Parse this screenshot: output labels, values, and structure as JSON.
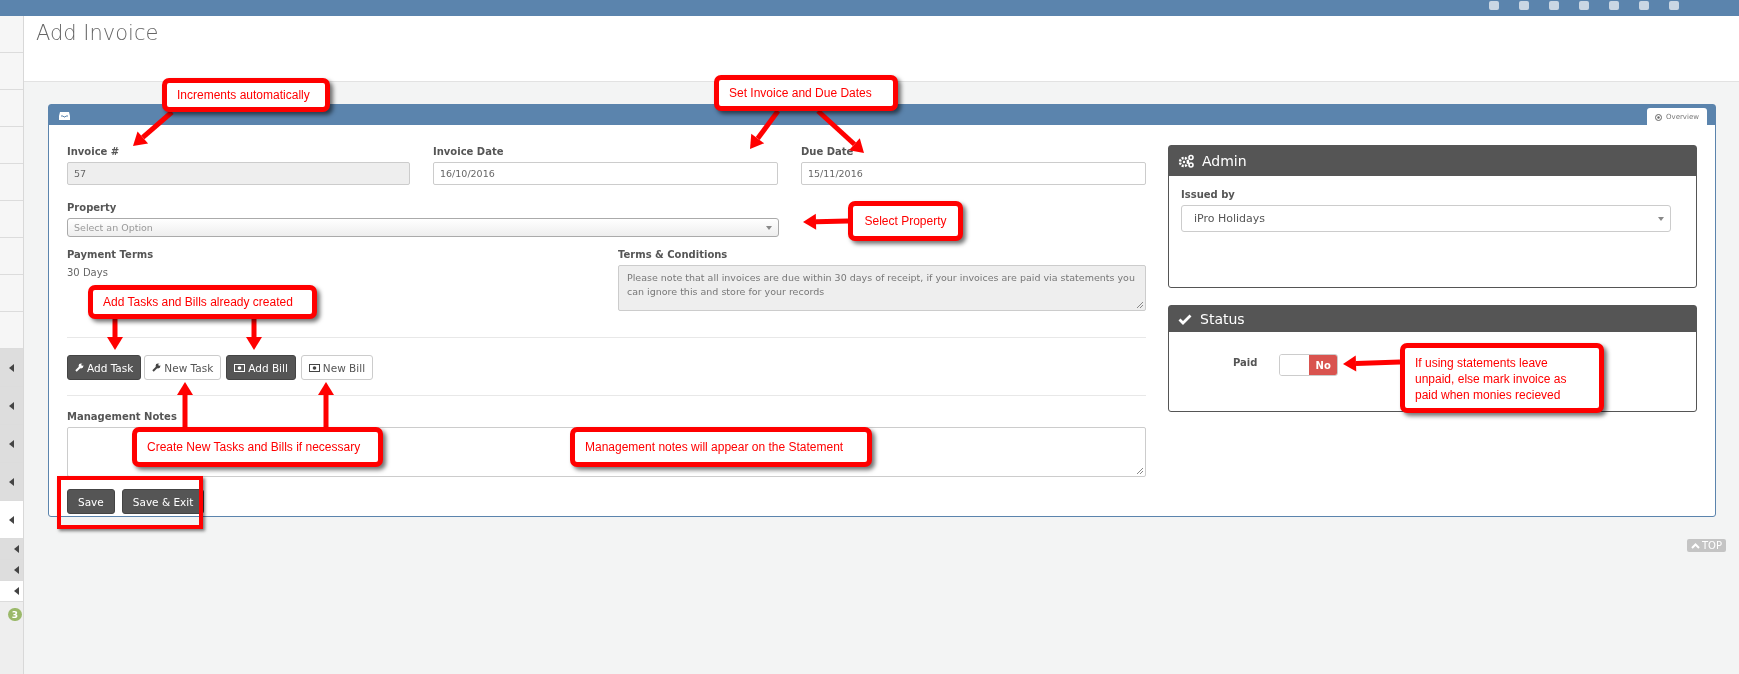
{
  "sidebar": {
    "items": [
      {
        "kind": "plain"
      },
      {
        "kind": "plain"
      },
      {
        "kind": "plain"
      },
      {
        "kind": "plain"
      },
      {
        "kind": "plain"
      },
      {
        "kind": "plain"
      },
      {
        "kind": "plain"
      },
      {
        "kind": "plain"
      },
      {
        "kind": "plain"
      },
      {
        "kind": "menu",
        "selected": false
      },
      {
        "kind": "menu",
        "selected": false
      },
      {
        "kind": "menu",
        "selected": false
      },
      {
        "kind": "menu",
        "selected": false
      },
      {
        "kind": "menu",
        "selected": true
      },
      {
        "kind": "sub",
        "selected": false
      },
      {
        "kind": "sub",
        "selected": false
      },
      {
        "kind": "sub",
        "selected": true
      }
    ],
    "badge": "3"
  },
  "page_title": "Add Invoice",
  "panel": {
    "tabs": [
      {
        "label": "Overview",
        "selected": true
      }
    ]
  },
  "fields": [
    {
      "label": "Invoice #",
      "value": "57",
      "disabled": true
    },
    {
      "label": "Invoice Date",
      "value": "16/10/2016",
      "disabled": false
    },
    {
      "label": "Due Date",
      "value": "15/11/2016",
      "disabled": false
    }
  ],
  "property": {
    "label": "Property",
    "placeholder": "Select an Option"
  },
  "payment_terms": {
    "label": "Payment Terms",
    "value": "30 Days"
  },
  "terms": {
    "label": "Terms & Conditions",
    "value": "Please note that all invoices are due within 30 days of receipt, if your invoices are paid via statements you can ignore this and store for your records",
    "disabled": true
  },
  "item_buttons": [
    {
      "label": "Add Task",
      "kind": "primary"
    },
    {
      "label": "New Task",
      "kind": "default"
    },
    {
      "label": "Add Bill",
      "kind": "primary"
    },
    {
      "label": "New Bill",
      "kind": "default"
    }
  ],
  "notes": {
    "label": "Management Notes"
  },
  "actions": [
    "Save",
    "Save & Exit"
  ],
  "admin": {
    "title": "Admin",
    "issued_by": {
      "label": "Issued by",
      "value": "iPro Holidays"
    }
  },
  "status": {
    "title": "Status",
    "paid": {
      "label": "Paid",
      "on": false,
      "text": "No"
    }
  },
  "top_link": "TOP",
  "callouts": [
    {
      "text": "Increments automatically"
    },
    {
      "text": "Set Invoice and Due Dates"
    },
    {
      "text": "Select Property"
    },
    {
      "text": "Add Tasks and Bills already created"
    },
    {
      "text": "Create New Tasks and Bills if necessary"
    },
    {
      "text": "Management notes will appear on the Statement"
    },
    {
      "text": "If using statements leave unpaid, else mark invoice as paid when monies recieved"
    }
  ],
  "save_highlight": true
}
